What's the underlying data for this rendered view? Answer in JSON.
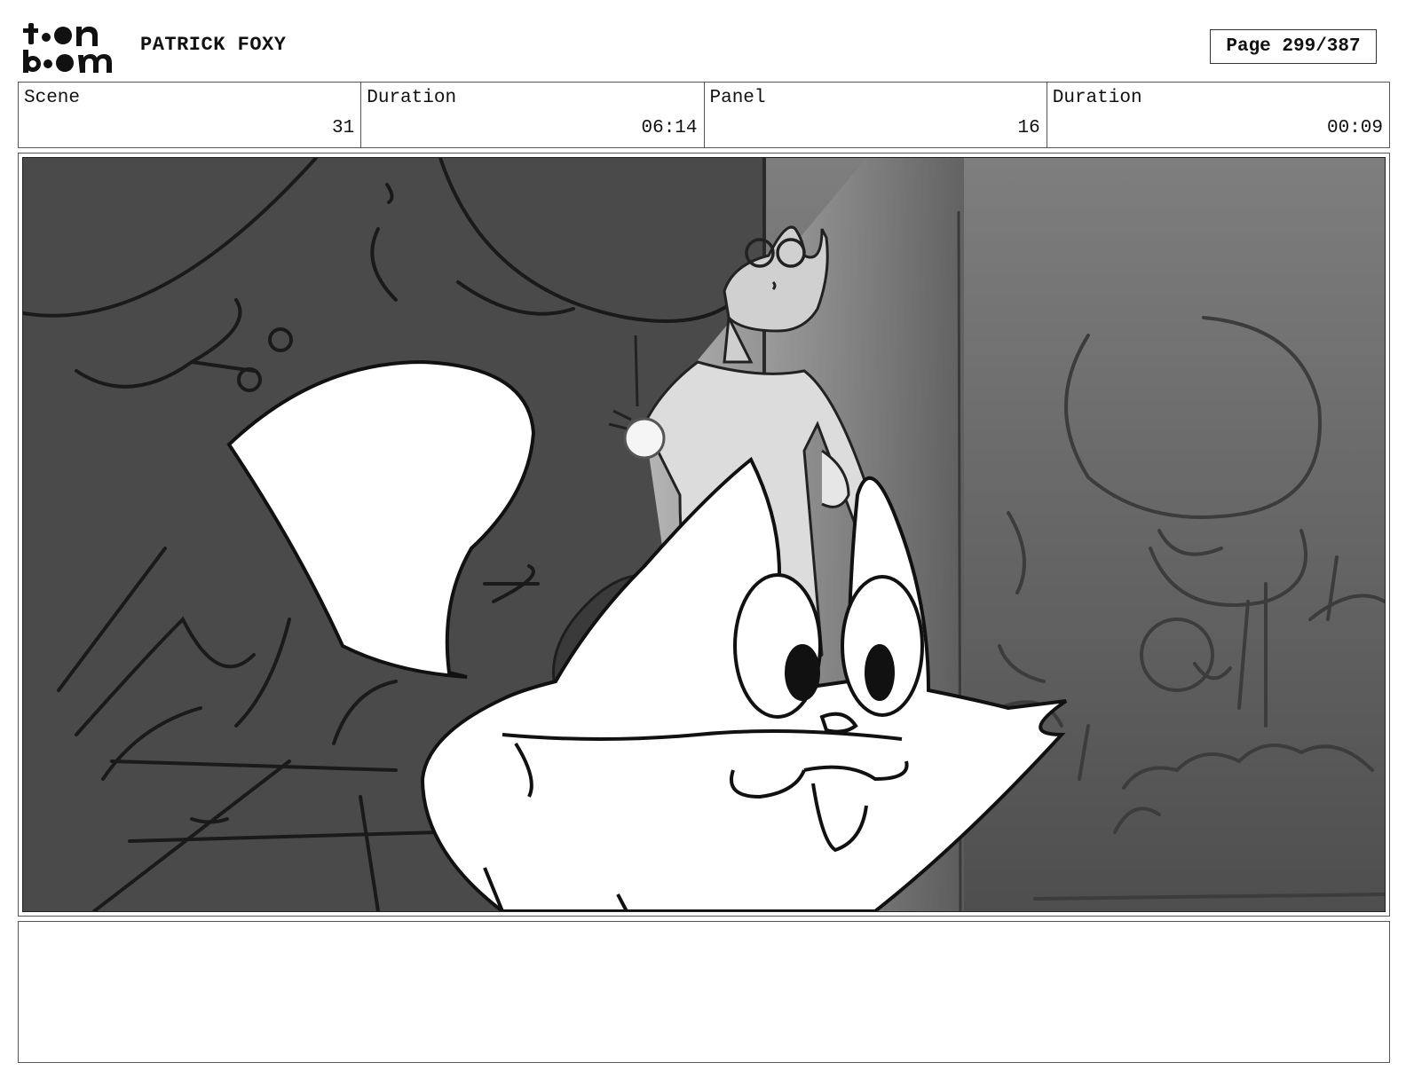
{
  "header": {
    "logo_line1": "toon",
    "logo_line2": "boom",
    "project_title": "PATRICK FOXY",
    "page_indicator": "Page 299/387"
  },
  "info": {
    "scene_label": "Scene",
    "scene_value": "31",
    "scene_duration_label": "Duration",
    "scene_duration_value": "06:14",
    "panel_label": "Panel",
    "panel_value": "16",
    "panel_duration_label": "Duration",
    "panel_duration_value": "00:09"
  },
  "notes": {
    "text": ""
  },
  "colors": {
    "background_dark": "#4a4a4a",
    "light_beam": "#9a9a9a",
    "sketch_line": "#111111"
  }
}
